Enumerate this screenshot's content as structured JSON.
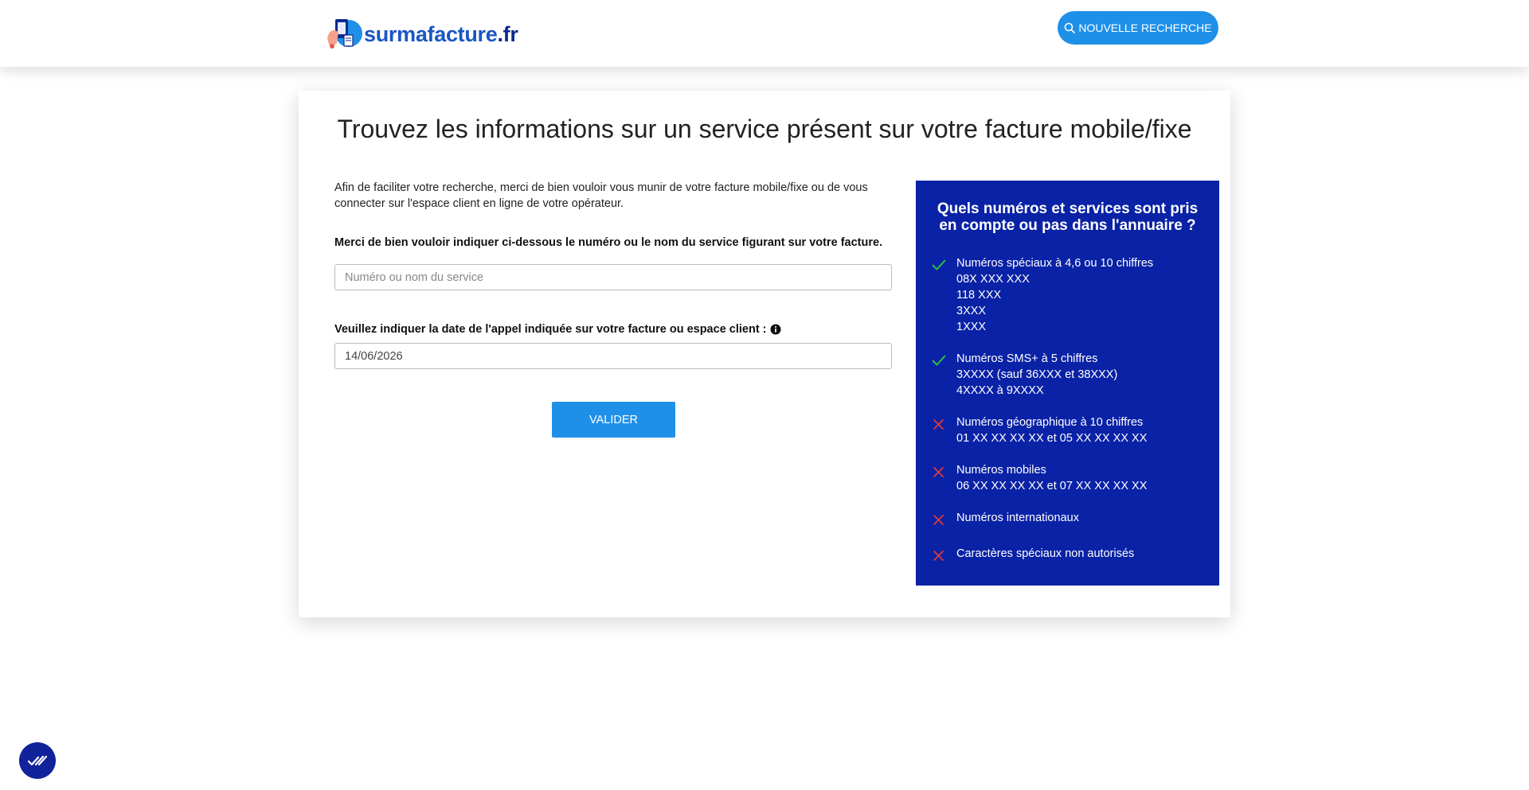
{
  "header": {
    "logo": {
      "brand": "surmafacture",
      "tld": ".fr"
    },
    "new_search_label": "NOUVELLE RECHERCHE"
  },
  "main": {
    "title": "Trouvez les informations sur un service présent sur votre facture mobile/fixe",
    "intro": "Afin de faciliter votre recherche, merci de bien vouloir vous munir de votre facture mobile/fixe ou de vous connecter sur l'espace client en ligne de votre opérateur.",
    "service_label": "Merci de bien vouloir indiquer ci-dessous le numéro ou le nom du service figurant sur votre facture.",
    "service_placeholder": "Numéro ou nom du service",
    "service_value": "",
    "date_label": "Veuillez indiquer la date de l'appel indiquée sur votre facture ou espace client :",
    "date_value": "14/06/2026",
    "submit_label": "VALIDER"
  },
  "panel": {
    "title": "Quels numéros et services sont pris en compte ou pas dans l'annuaire ?",
    "rules": [
      {
        "status": "included",
        "icon": "check-icon",
        "lines": [
          "Numéros spéciaux à 4,6 ou 10 chiffres",
          "08X XXX XXX",
          "118 XXX",
          "3XXX",
          "1XXX"
        ]
      },
      {
        "status": "included",
        "icon": "check-icon",
        "lines": [
          "Numéros SMS+ à 5 chiffres",
          "3XXXX (sauf 36XXX et 38XXX)",
          "4XXXX à 9XXXX"
        ]
      },
      {
        "status": "excluded",
        "icon": "cross-icon",
        "lines": [
          "Numéros géographique à 10 chiffres",
          "01 XX XX XX XX et 05 XX XX XX XX"
        ]
      },
      {
        "status": "excluded",
        "icon": "cross-icon",
        "lines": [
          "Numéros mobiles",
          "06 XX XX XX XX et 07 XX XX XX XX"
        ]
      },
      {
        "status": "excluded",
        "icon": "cross-icon",
        "lines": [
          "Numéros internationaux"
        ]
      },
      {
        "status": "excluded",
        "icon": "cross-icon",
        "lines": [
          "Caractères spéciaux non autorisés"
        ]
      }
    ]
  },
  "colors": {
    "accent": "#1e90e8",
    "panel_bg": "#0a22a6",
    "check": "#2ecc40",
    "cross": "#e53935"
  },
  "icons": [
    "search-icon",
    "info-icon",
    "check-icon",
    "cross-icon",
    "cookie-consent-icon"
  ]
}
